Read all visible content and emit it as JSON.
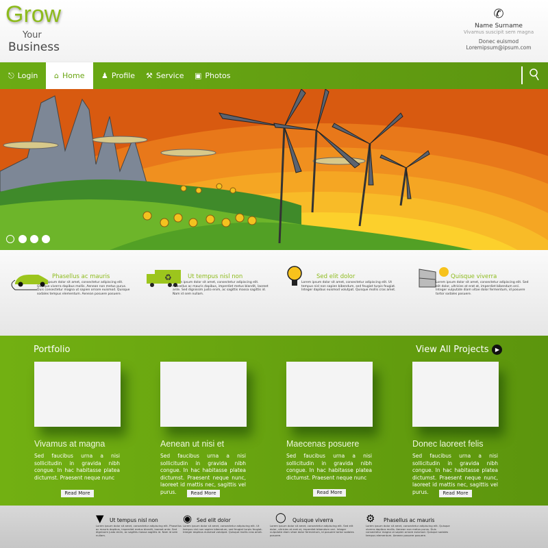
{
  "header": {
    "logo": {
      "line1": "Grow",
      "line2": "Your",
      "line3": "Business"
    },
    "contact": {
      "name": "Name Surname",
      "subtitle": "Vivamus suscipit sem magna",
      "line1": "Donec euismod",
      "email": "Loremipsum@ipsum.com"
    }
  },
  "nav": {
    "items": [
      {
        "label": "Login",
        "icon": "login-icon"
      },
      {
        "label": "Home",
        "icon": "home-icon",
        "active": true
      },
      {
        "label": "Profile",
        "icon": "profile-icon"
      },
      {
        "label": "Service",
        "icon": "service-icon"
      },
      {
        "label": "Photos",
        "icon": "camera-icon"
      }
    ],
    "search_icon": "search-icon"
  },
  "hero": {
    "slides": 4,
    "active_slide": 0
  },
  "features": [
    {
      "title": "Phasellus ac mauris",
      "body": "Lorem ipsum dolor sit amet, consectetur adipiscing elit. Quisque viverra dapibus mollis. Aenean non metus purus. Duis consectetur magna ut sapien ornare euismod. Quisque sodales tempus elementum. Aenean posuere posuere.",
      "icon": "electric-car-icon"
    },
    {
      "title": "Ut tempus nisl non",
      "body": "Lorem ipsum dolor sit amet, consectetur adipiscing elit. Phasellus ac mauris dapibus, imperdiet metus blandit, laoreet ante. Sed dignissim justo enim, ac sagittis massa sagittis id. Nam id sem nullam.",
      "icon": "recycling-truck-icon"
    },
    {
      "title": "Sed elit dolor",
      "body": "Lorem ipsum dolor sit amet, consectetur adipiscing elit. Ut tempus nisl non sapien bibendum, sed feugiat turpis feugiat. Integer dapibus euismod volutpat. Quisque mollis cras amet.",
      "icon": "light-bulb-icon"
    },
    {
      "title": "Quisque viverra",
      "body": "Lorem ipsum dolor sit amet, consectetur adipiscing elit. Sed elit dolor, ultricies at erat at, imperdiet bibendum orci. Integer vulputate diam vitae dolor fermentum, id posuere tortor sodales posuere.",
      "icon": "solar-panel-icon"
    }
  ],
  "portfolio": {
    "heading": "Portfolio",
    "view_all": "View All Projects",
    "cards": [
      {
        "title": "Vivamus at magna",
        "body": "Sed faucibus urna a nisi sollicitudin in gravida nibh congue. In hac habitasse platea dictumst. Praesent neque nunc",
        "button": "Read More"
      },
      {
        "title": "Aenean ut nisi et",
        "body": "Sed faucibus urna a nisi sollicitudin in gravida nibh congue. In hac habitasse platea dictumst. Praesent neque nunc, laoreet id mattis nec, sagittis vel purus.",
        "button": "Read More"
      },
      {
        "title": "Maecenas posuere",
        "body": "Sed faucibus urna a nisi sollicitudin in gravida nibh congue. In hac habitasse platea dictumst. Praesent neque nunc",
        "button": "Read More"
      },
      {
        "title": "Donec laoreet felis",
        "body": "Sed faucibus urna a nisi sollicitudin in gravida nibh congue. In hac habitasse platea dictumst. Praesent neque nunc, laoreet id mattis nec, sagittis vel purus.",
        "button": "Read More"
      }
    ]
  },
  "footer": [
    {
      "title": "Ut tempus nisl non",
      "body": "Lorem ipsum dolor sit amet, consectetur adipiscing elit. Phasellus ac mauris dapibus, imperdiet metus blandit, laoreet ante. Sed dignissim justo enim, ac sagittis massa sagittis id. Nam id sem nullam.",
      "icon": "map-pin-icon"
    },
    {
      "title": "Sed elit dolor",
      "body": "Lorem ipsum dolor sit amet, consectetur adipiscing elit. Ut tempus nisl non sapien bibendum, sed feugiat turpis feugiat. Integer dapibus euismod volutpat. Quisque mollis cras amet.",
      "icon": "globe-icon"
    },
    {
      "title": "Quisque viverra",
      "body": "Lorem ipsum dolor sit amet, consectetur adipiscing elit. Sed elit dolor, ultricies at erat at, imperdiet bibendum orci. Integer vulputate diam vitae dolor fermentum, id posuere tortor sodales posuere.",
      "icon": "light-bulb-icon"
    },
    {
      "title": "Phasellus ac mauris",
      "body": "Lorem ipsum dolor sit amet, consectetur adipiscing elit. Quisque viverra dapibus mollis. Aenean non metus purus. Duis consectetur magna ut sapien ornare euismod. Quisque sodales tempus elementum. Aenean posuere posuere.",
      "icon": "tools-icon"
    }
  ],
  "colors": {
    "brand_green": "#6aa512",
    "accent_lime": "#8dbb1c",
    "hero_orange": "#e56a12"
  }
}
